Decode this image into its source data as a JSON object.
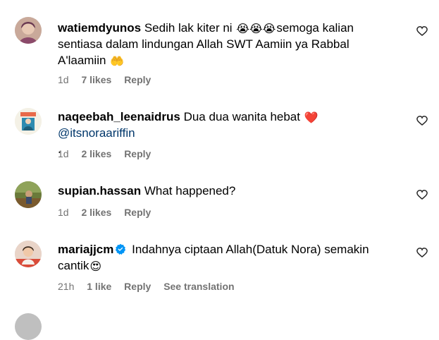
{
  "comments": [
    {
      "username": "watiemdyunos",
      "text_before": "Sedih lak kiter ni ",
      "emojis_1": "😭😭😭",
      "text_after": "semoga kalian sentiasa dalam lindungan Allah SWT Aamiin ya Rabbal A'laamiin ",
      "emojis_2": "🤲",
      "time": "1d",
      "likes": "7 likes",
      "reply": "Reply"
    },
    {
      "username": "naqeebah_leenaidrus",
      "text_before": "Dua dua wanita hebat ",
      "emojis_1": "❤️",
      "mention": "@itsnoraariffin",
      "text_after": ".",
      "time": "1d",
      "likes": "2 likes",
      "reply": "Reply"
    },
    {
      "username": "supian.hassan",
      "text_before": "What happened?",
      "time": "1d",
      "likes": "2 likes",
      "reply": "Reply"
    },
    {
      "username": "mariajjcm",
      "verified": true,
      "text_before": "Indahnya ciptaan Allah(Datuk Nora) semakin cantik",
      "emojis_1": "😍",
      "time": "21h",
      "likes": "1 like",
      "reply": "Reply",
      "translation": "See translation"
    }
  ],
  "colors": {
    "text": "#000000",
    "meta": "#737373",
    "mention": "#00376b",
    "verified": "#0095f6",
    "heart_red": "#ed1c24"
  },
  "icons": [
    "like-heart-icon",
    "verified-badge-icon"
  ]
}
